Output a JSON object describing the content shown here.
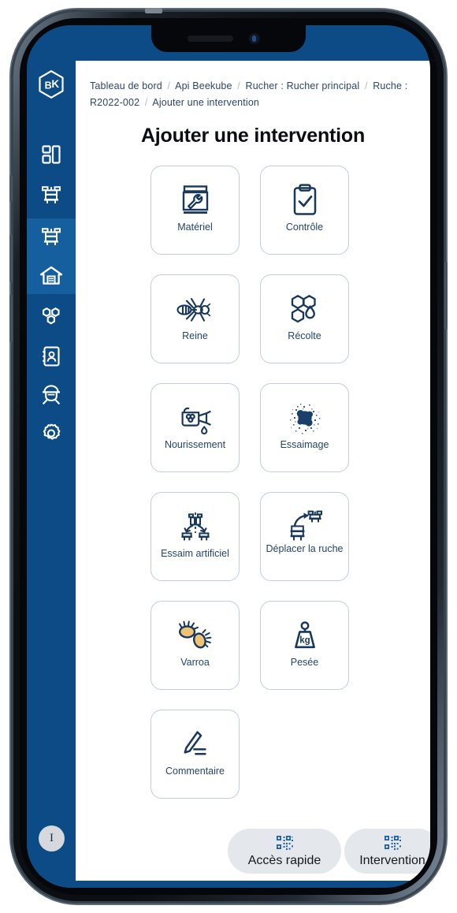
{
  "app": {
    "logo_label": "BK",
    "sidebar_accent": "#165f9e",
    "sidebar_bg": "#0c4b85",
    "brand_navy": "#17385c"
  },
  "sidebar": {
    "logo_name": "beekube-hexagon-logo",
    "items": [
      {
        "name": "dashboard-icon",
        "label": "Tableau de bord",
        "active": false
      },
      {
        "name": "hive-icon",
        "label": "Ruches",
        "active": false
      },
      {
        "name": "hive-detail-icon",
        "label": "Ruche",
        "active": true
      },
      {
        "name": "apiary-icon",
        "label": "Rucher",
        "active": true
      },
      {
        "name": "honeycomb-icon",
        "label": "Colonies",
        "active": false
      },
      {
        "name": "contact-book-icon",
        "label": "Contacts",
        "active": false
      },
      {
        "name": "beekeeper-icon",
        "label": "Apiculteur",
        "active": false
      },
      {
        "name": "gear-icon",
        "label": "Paramètres",
        "active": false
      }
    ],
    "avatar_initial": "I"
  },
  "breadcrumb": {
    "items": [
      "Tableau de bord",
      "Api Beekube",
      "Rucher : Rucher principal",
      "Ruche : R2022-002",
      "Ajouter une intervention"
    ],
    "separator": "/"
  },
  "page": {
    "title": "Ajouter une intervention"
  },
  "interventions": [
    {
      "label": "Matériel",
      "icon": "hive-box-wrench-icon"
    },
    {
      "label": "Contrôle",
      "icon": "clipboard-check-icon"
    },
    {
      "label": "Reine",
      "icon": "queen-bee-icon"
    },
    {
      "label": "Récolte",
      "icon": "honeycomb-drop-icon"
    },
    {
      "label": "Nourissement",
      "icon": "watering-can-icon"
    },
    {
      "label": "Essaimage",
      "icon": "swarm-cloud-icon"
    },
    {
      "label": "Essaim artificiel",
      "icon": "hive-split-icon"
    },
    {
      "label": "Déplacer la ruche",
      "icon": "move-hive-icon"
    },
    {
      "label": "Varroa",
      "icon": "varroa-mite-icon"
    },
    {
      "label": "Pesée",
      "icon": "kg-weight-icon"
    },
    {
      "label": "Commentaire",
      "icon": "pencil-note-icon"
    }
  ],
  "floating_actions": [
    {
      "label": "Accès rapide",
      "icon": "qr-code-icon"
    },
    {
      "label": "Intervention",
      "icon": "qr-code-icon"
    }
  ],
  "device": {
    "notch_speaker": "speaker-grille",
    "notch_camera": "front-camera"
  }
}
